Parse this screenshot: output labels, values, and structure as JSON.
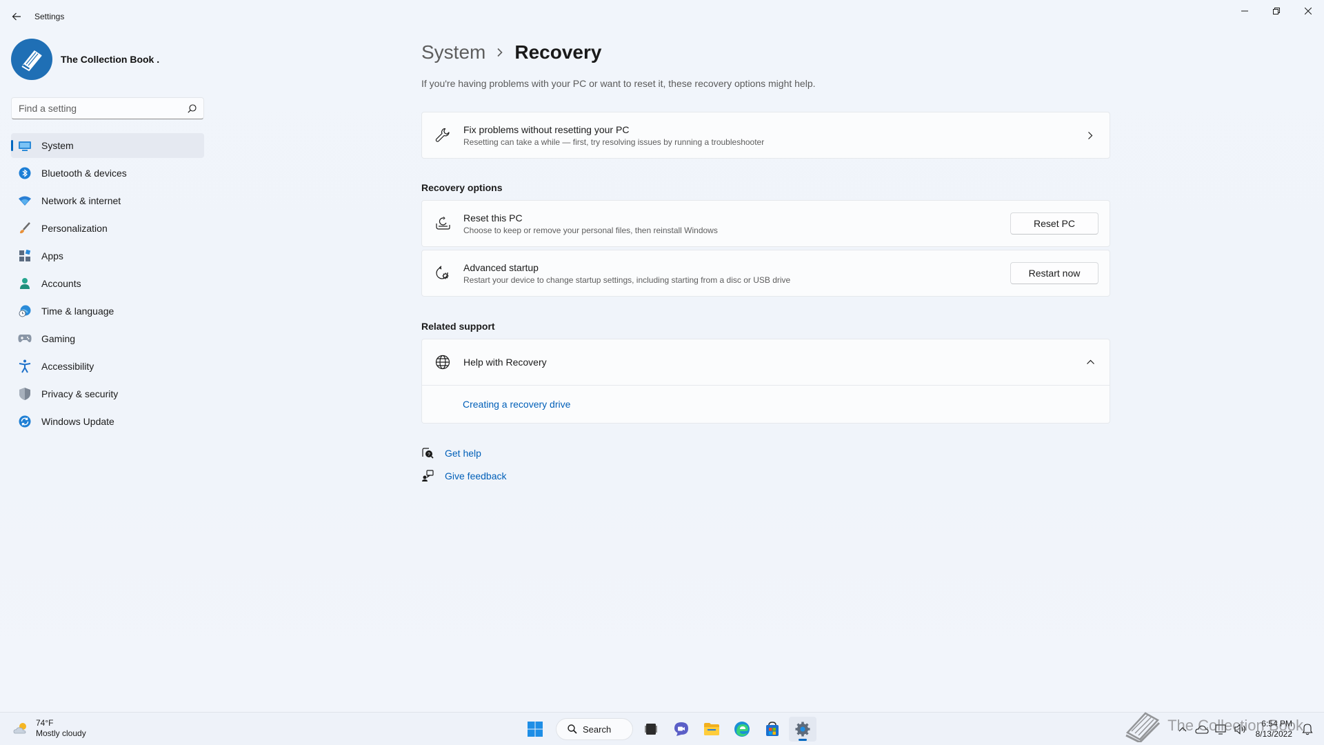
{
  "window": {
    "app_title": "Settings",
    "profile_name": "The Collection Book ."
  },
  "search": {
    "placeholder": "Find a setting"
  },
  "sidebar": {
    "items": [
      {
        "label": "System",
        "icon": "monitor-icon",
        "active": true
      },
      {
        "label": "Bluetooth & devices",
        "icon": "bluetooth-icon"
      },
      {
        "label": "Network & internet",
        "icon": "wifi-icon"
      },
      {
        "label": "Personalization",
        "icon": "brush-icon"
      },
      {
        "label": "Apps",
        "icon": "apps-icon"
      },
      {
        "label": "Accounts",
        "icon": "person-icon"
      },
      {
        "label": "Time & language",
        "icon": "globe-clock-icon"
      },
      {
        "label": "Gaming",
        "icon": "gamepad-icon"
      },
      {
        "label": "Accessibility",
        "icon": "accessibility-icon"
      },
      {
        "label": "Privacy & security",
        "icon": "shield-icon"
      },
      {
        "label": "Windows Update",
        "icon": "update-icon"
      }
    ]
  },
  "main": {
    "breadcrumb_parent": "System",
    "breadcrumb_current": "Recovery",
    "intro": "If you're having problems with your PC or want to reset it, these recovery options might help.",
    "fix_card": {
      "title": "Fix problems without resetting your PC",
      "subtitle": "Resetting can take a while — first, try resolving issues by running a troubleshooter"
    },
    "recovery_options_title": "Recovery options",
    "reset_card": {
      "title": "Reset this PC",
      "subtitle": "Choose to keep or remove your personal files, then reinstall Windows",
      "button": "Reset PC"
    },
    "advanced_card": {
      "title": "Advanced startup",
      "subtitle": "Restart your device to change startup settings, including starting from a disc or USB drive",
      "button": "Restart now"
    },
    "related_support_title": "Related support",
    "help_card": {
      "title": "Help with Recovery",
      "link": "Creating a recovery drive"
    },
    "get_help": "Get help",
    "give_feedback": "Give feedback"
  },
  "taskbar": {
    "weather_temp": "74°F",
    "weather_desc": "Mostly cloudy",
    "search_label": "Search",
    "time": "6:54 PM",
    "date": "8/13/2022",
    "watermark": "The Collection Book"
  },
  "colors": {
    "accent": "#0067c0",
    "link": "#005fb8"
  }
}
